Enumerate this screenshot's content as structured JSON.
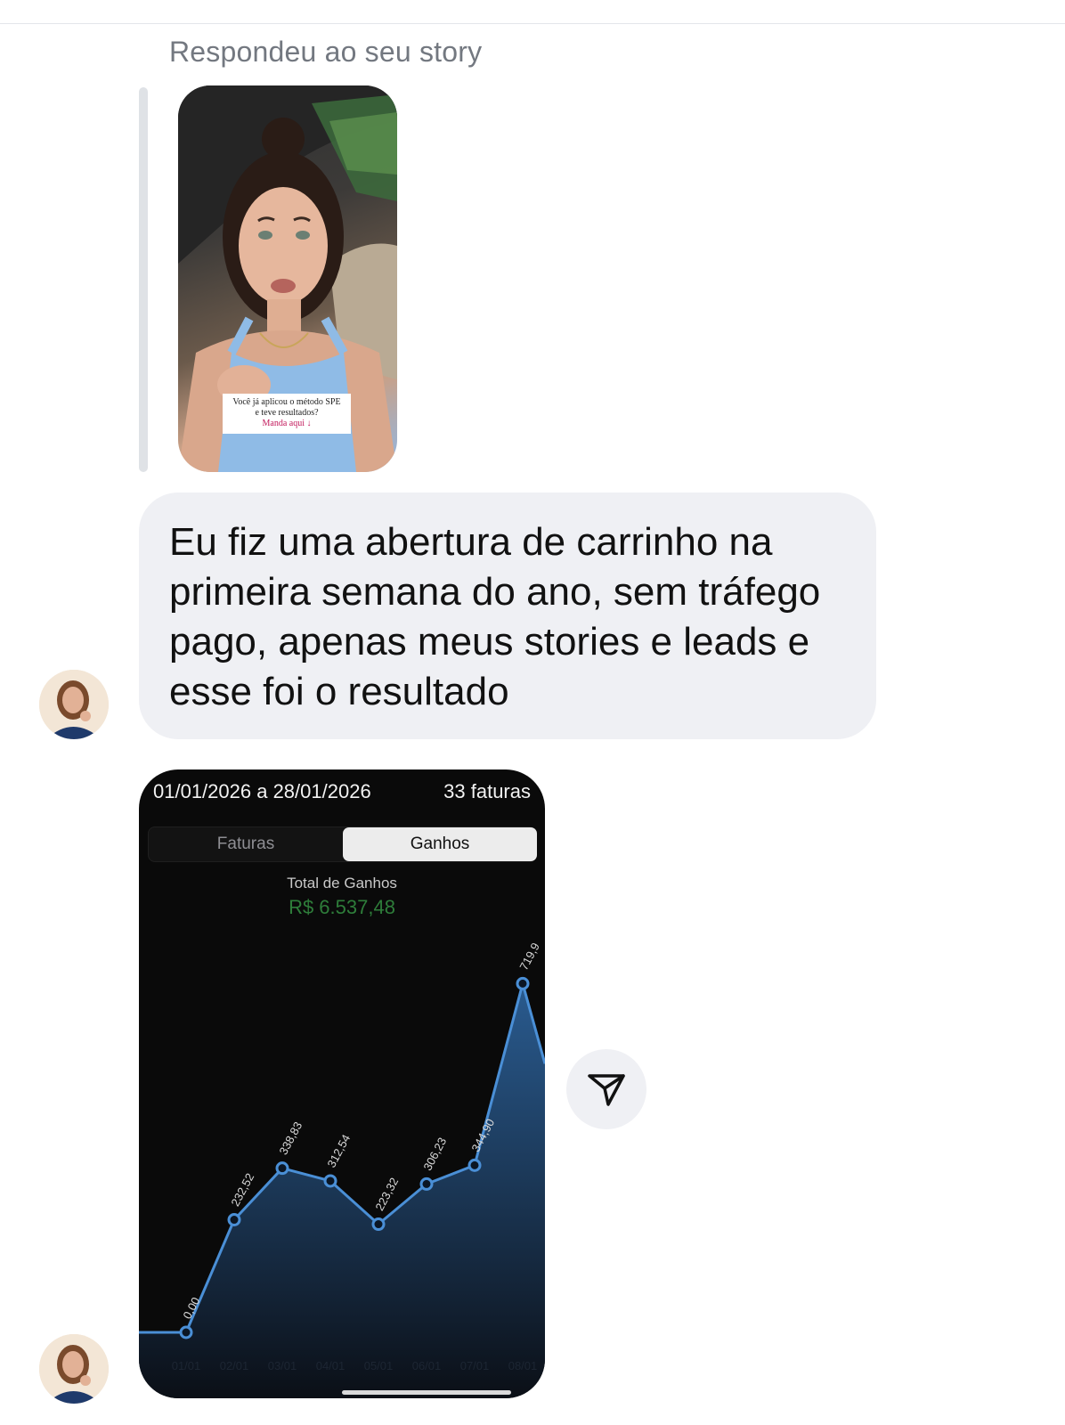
{
  "reply": {
    "caption": "Respondeu ao seu story",
    "story_sticker_line1": "Você já aplicou o método SPE",
    "story_sticker_line2": "e teve resultados?",
    "story_sticker_cta": "Manda aqui ↓"
  },
  "message": {
    "text": "Eu fiz uma abertura de carrinho na primeira semana do ano, sem tráfego pago, apenas meus stories e leads e esse foi o resultado"
  },
  "screenshot_card": {
    "date_range": "01/01/2026 a 28/01/2026",
    "invoice_count": "33 faturas",
    "tabs": [
      "Faturas",
      "Ganhos"
    ],
    "active_tab": "Ganhos",
    "total_label": "Total de Ganhos",
    "total_value": "R$ 6.537,48",
    "total_color": "#2e7d3a",
    "line_color": "#4a8fd6"
  },
  "chart_data": {
    "type": "area",
    "categories": [
      "01/01",
      "02/01",
      "03/01",
      "04/01",
      "05/01",
      "06/01",
      "07/01",
      "08/01"
    ],
    "values": [
      0.0,
      232.52,
      338.83,
      312.54,
      223.32,
      306.23,
      344.9,
      719.9
    ],
    "data_labels": [
      "0,00",
      "232,52",
      "338,83",
      "312,54",
      "223,32",
      "306,23",
      "344,90",
      "719,9"
    ],
    "title": "",
    "xlabel": "",
    "ylabel": "",
    "grid": false
  },
  "icons": {
    "share": "paper-plane-icon"
  }
}
